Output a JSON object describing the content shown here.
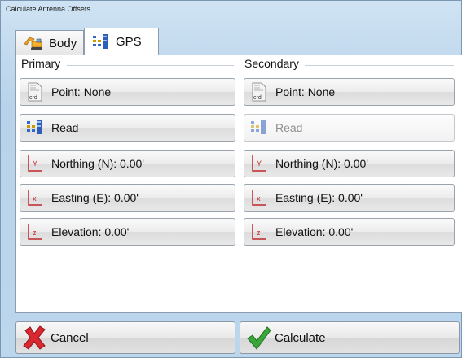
{
  "window": {
    "title": "Calculate Antenna Offsets"
  },
  "tabs": [
    {
      "label": "Body",
      "icon": "excavator-icon"
    },
    {
      "label": "GPS",
      "icon": "gps-bars-icon"
    }
  ],
  "primary": {
    "label": "Primary",
    "point": "Point: None",
    "read": "Read",
    "northing": "Northing (N): 0.00'",
    "easting": "Easting (E): 0.00'",
    "elevation": "Elevation: 0.00'"
  },
  "secondary": {
    "label": "Secondary",
    "point": "Point: None",
    "read": "Read",
    "northing": "Northing (N): 0.00'",
    "easting": "Easting (E): 0.00'",
    "elevation": "Elevation: 0.00'"
  },
  "footer": {
    "cancel": "Cancel",
    "calculate": "Calculate"
  },
  "icon_labels": {
    "crd": "crd",
    "y": "Y",
    "x": "x",
    "z": "z"
  },
  "colors": {
    "cancel_x": "#d9282f",
    "calculate_check": "#3aa63a",
    "axis": "#c0262c"
  }
}
